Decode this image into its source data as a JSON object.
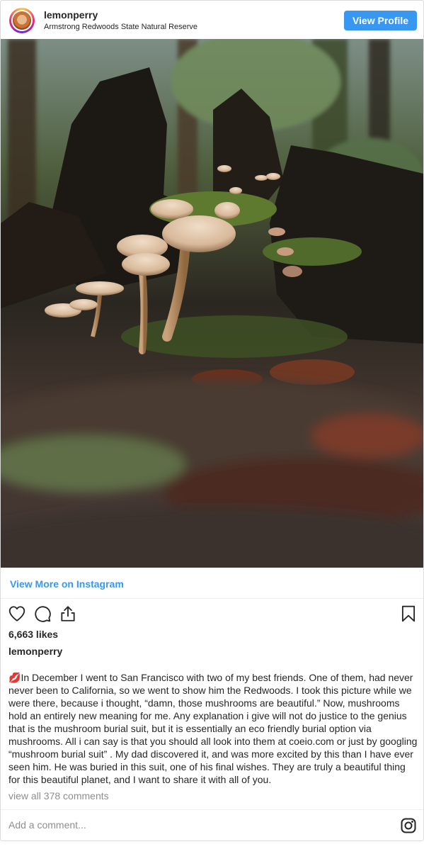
{
  "header": {
    "username": "lemonperry",
    "location": "Armstrong Redwoods State Natural Reserve",
    "view_profile_label": "View Profile",
    "avatar_icon": "profile-photo"
  },
  "post": {
    "view_more_label": "View More on Instagram",
    "likes": "6,663 likes",
    "caption_user": "lemonperry",
    "caption_emoji": "💋",
    "caption_text": "In December I went to San Francisco with two of my best friends. One of them, had never never been to California, so we went to show him the Redwoods. I took this picture while we were there, because i thought, “damn, those mushrooms are beautiful.” Now, mushrooms hold an entirely new meaning for me. Any explanation i give will not do justice to the genius that is the mushroom burial suit, but it is essentially an eco friendly burial option via mushrooms. All i can say is that you should all look into them at coeio.com or just by googling “mushroom burial suit” . My dad discovered it, and was more excited by this than I have ever seen him. He was buried in this suit, one of his final wishes. They are truly a beautiful thing for this beautiful planet, and I want to share it with all of you.",
    "view_comments": "view all 378 comments"
  },
  "comment_box": {
    "placeholder": "Add a comment..."
  },
  "icons": {
    "like": "heart-icon",
    "comment": "comment-icon",
    "share": "share-icon",
    "save": "bookmark-icon",
    "brand": "instagram-icon"
  },
  "colors": {
    "accent": "#3897f0",
    "text": "#262626",
    "muted": "#8e8e8e",
    "border": "#dbdbdb"
  }
}
